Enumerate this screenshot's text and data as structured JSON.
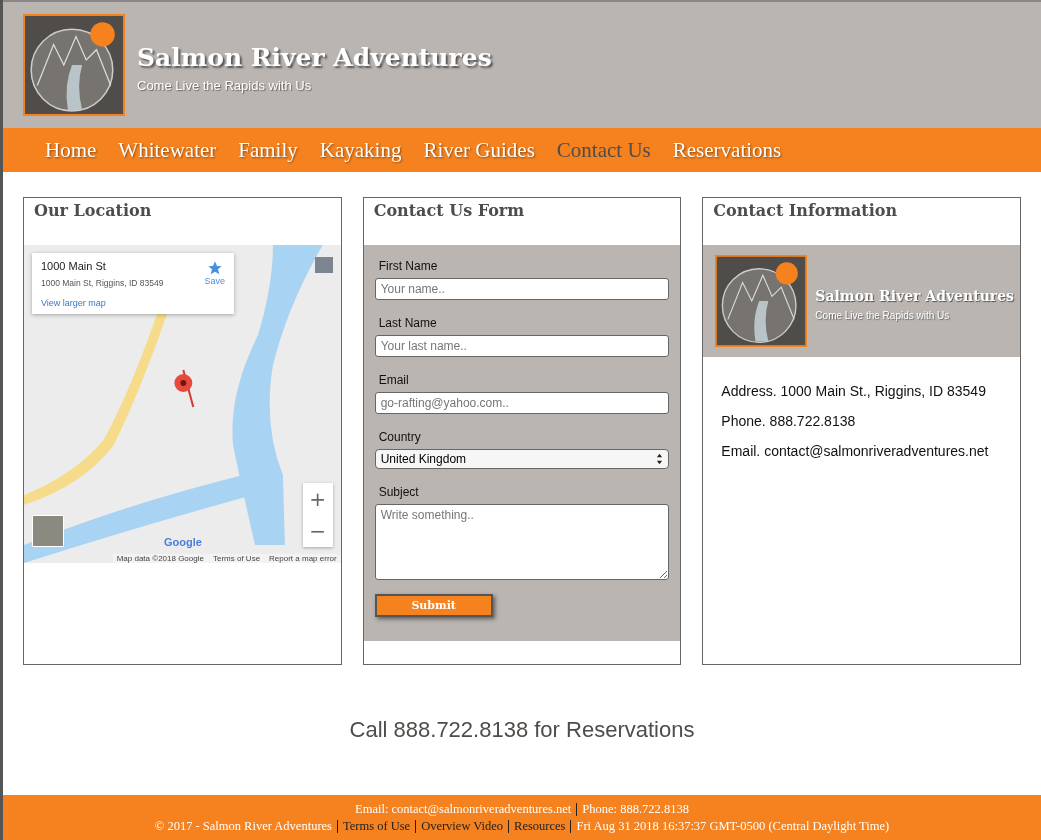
{
  "header": {
    "title": "Salmon River Adventures",
    "tagline": "Come Live the Rapids with Us"
  },
  "nav": [
    {
      "label": "Home",
      "selected": false
    },
    {
      "label": "Whitewater",
      "selected": false
    },
    {
      "label": "Family",
      "selected": false
    },
    {
      "label": "Kayaking",
      "selected": false
    },
    {
      "label": "River Guides",
      "selected": false
    },
    {
      "label": "Contact Us",
      "selected": true
    },
    {
      "label": "Reservations",
      "selected": false
    }
  ],
  "location": {
    "heading": "Our Location",
    "map": {
      "place_title": "1000 Main St",
      "place_address": "1000 Main St, Riggins, ID 83549",
      "save": "Save",
      "larger_map": "View larger map",
      "zoom_in": "+",
      "zoom_out": "−",
      "logo": "Google",
      "attribution": [
        "Map data ©2018 Google",
        "Terms of Use",
        "Report a map error"
      ]
    }
  },
  "form": {
    "heading": "Contact Us Form",
    "fields": [
      {
        "kind": "input",
        "label": "First Name",
        "placeholder": "Your name.."
      },
      {
        "kind": "input",
        "label": "Last Name",
        "placeholder": "Your last name.."
      },
      {
        "kind": "input",
        "label": "Email",
        "placeholder": "go-rafting@yahoo.com.."
      },
      {
        "kind": "select",
        "label": "Country",
        "value": "United Kingdom"
      },
      {
        "kind": "textarea",
        "label": "Subject",
        "placeholder": "Write something.."
      }
    ],
    "submit": "Submit"
  },
  "contact": {
    "heading": "Contact Information",
    "title": "Salmon River Adventures",
    "tagline": "Come Live the Rapids with Us",
    "lines": [
      "Address. 1000 Main St., Riggins, ID 83549",
      "Phone. 888.722.8138",
      "Email. contact@salmonriveradventures.net"
    ]
  },
  "reservation_call": "Call 888.722.8138 for Reservations",
  "footer": {
    "line_1": [
      "Email: contact@salmonriveradventures.net",
      "Phone: 888.722.8138"
    ],
    "line_2": [
      {
        "kind": "text",
        "label": "© 2017 - Salmon River Adventures"
      },
      {
        "kind": "link",
        "label": "Terms of Use"
      },
      {
        "kind": "link",
        "label": "Overview Video"
      },
      {
        "kind": "link",
        "label": "Resources"
      },
      {
        "kind": "text",
        "label": "Fri Aug 31 2018 16:37:37 GMT-0500 (Central Daylight Time)"
      }
    ]
  }
}
